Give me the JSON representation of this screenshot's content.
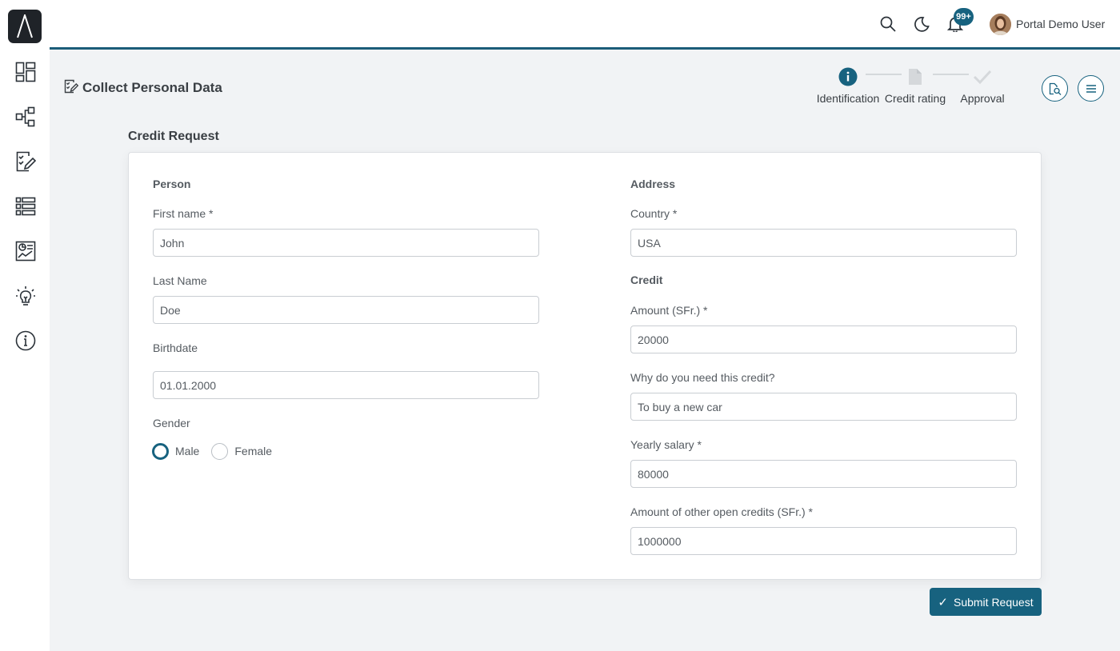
{
  "sidebar": {
    "logo": "axon-ivy-logo",
    "items": [
      {
        "icon": "dashboard-icon"
      },
      {
        "icon": "process-icon"
      },
      {
        "icon": "tasks-icon"
      },
      {
        "icon": "cases-icon"
      },
      {
        "icon": "statistics-icon"
      },
      {
        "icon": "lightbulb-icon"
      },
      {
        "icon": "info-icon"
      }
    ]
  },
  "topbar": {
    "notification_count": "99+",
    "user_name": "Portal Demo User"
  },
  "page": {
    "title": "Collect Personal Data",
    "steps": [
      {
        "label": "Identification",
        "state": "active"
      },
      {
        "label": "Credit rating",
        "state": "pending"
      },
      {
        "label": "Approval",
        "state": "pending"
      }
    ]
  },
  "form": {
    "section_title": "Credit Request",
    "person": {
      "title": "Person",
      "first_name_label": "First name  *",
      "first_name_value": "John",
      "last_name_label": "Last Name",
      "last_name_value": "Doe",
      "birthdate_label": "Birthdate",
      "birthdate_value": "01.01.2000",
      "gender_label": "Gender",
      "gender_options": [
        "Male",
        "Female"
      ],
      "gender_selected": "Male"
    },
    "address": {
      "title": "Address",
      "country_label": "Country  *",
      "country_value": "USA"
    },
    "credit": {
      "title": "Credit",
      "amount_label": "Amount (SFr.)  *",
      "amount_value": "20000",
      "reason_label": "Why do you need this credit?",
      "reason_value": "To buy a new car",
      "salary_label": "Yearly salary  *",
      "salary_value": "80000",
      "other_credits_label": "Amount of other open credits (SFr.)  *",
      "other_credits_value": "1000000"
    },
    "submit_label": "Submit Request"
  },
  "colors": {
    "accent": "#17627f",
    "topbar_line": "#1b5d79",
    "background": "#f1f3f5"
  }
}
